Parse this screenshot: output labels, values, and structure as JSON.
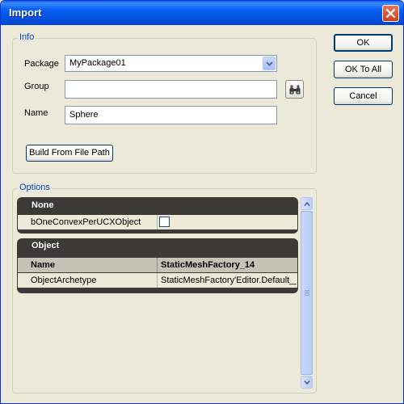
{
  "window": {
    "title": "Import"
  },
  "info": {
    "group_title": "Info",
    "package_label": "Package",
    "package_value": "MyPackage01",
    "group_label": "Group",
    "group_value": "",
    "name_label": "Name",
    "name_value": "Sphere",
    "build_button": "Build From File Path"
  },
  "buttons": {
    "ok": "OK",
    "ok_to_all": "OK To All",
    "cancel": "Cancel"
  },
  "options": {
    "group_title": "Options",
    "categories": [
      {
        "name": "None",
        "rows": [
          {
            "property": "bOneConvexPerUCXObject",
            "value_type": "checkbox",
            "checked": false
          }
        ]
      },
      {
        "name": "Object",
        "rows": [
          {
            "property": "Name",
            "value": "StaticMeshFactory_14"
          },
          {
            "property": "ObjectArchetype",
            "value": "StaticMeshFactory'Editor.Default__"
          }
        ]
      }
    ]
  },
  "colors": {
    "title_bar": "#0453e0",
    "accent": "#0046d5",
    "category_header": "#3b3a37"
  },
  "icons": {
    "close": "close-icon",
    "browse": "binoculars-icon",
    "dropdown": "chevron-down-icon"
  }
}
